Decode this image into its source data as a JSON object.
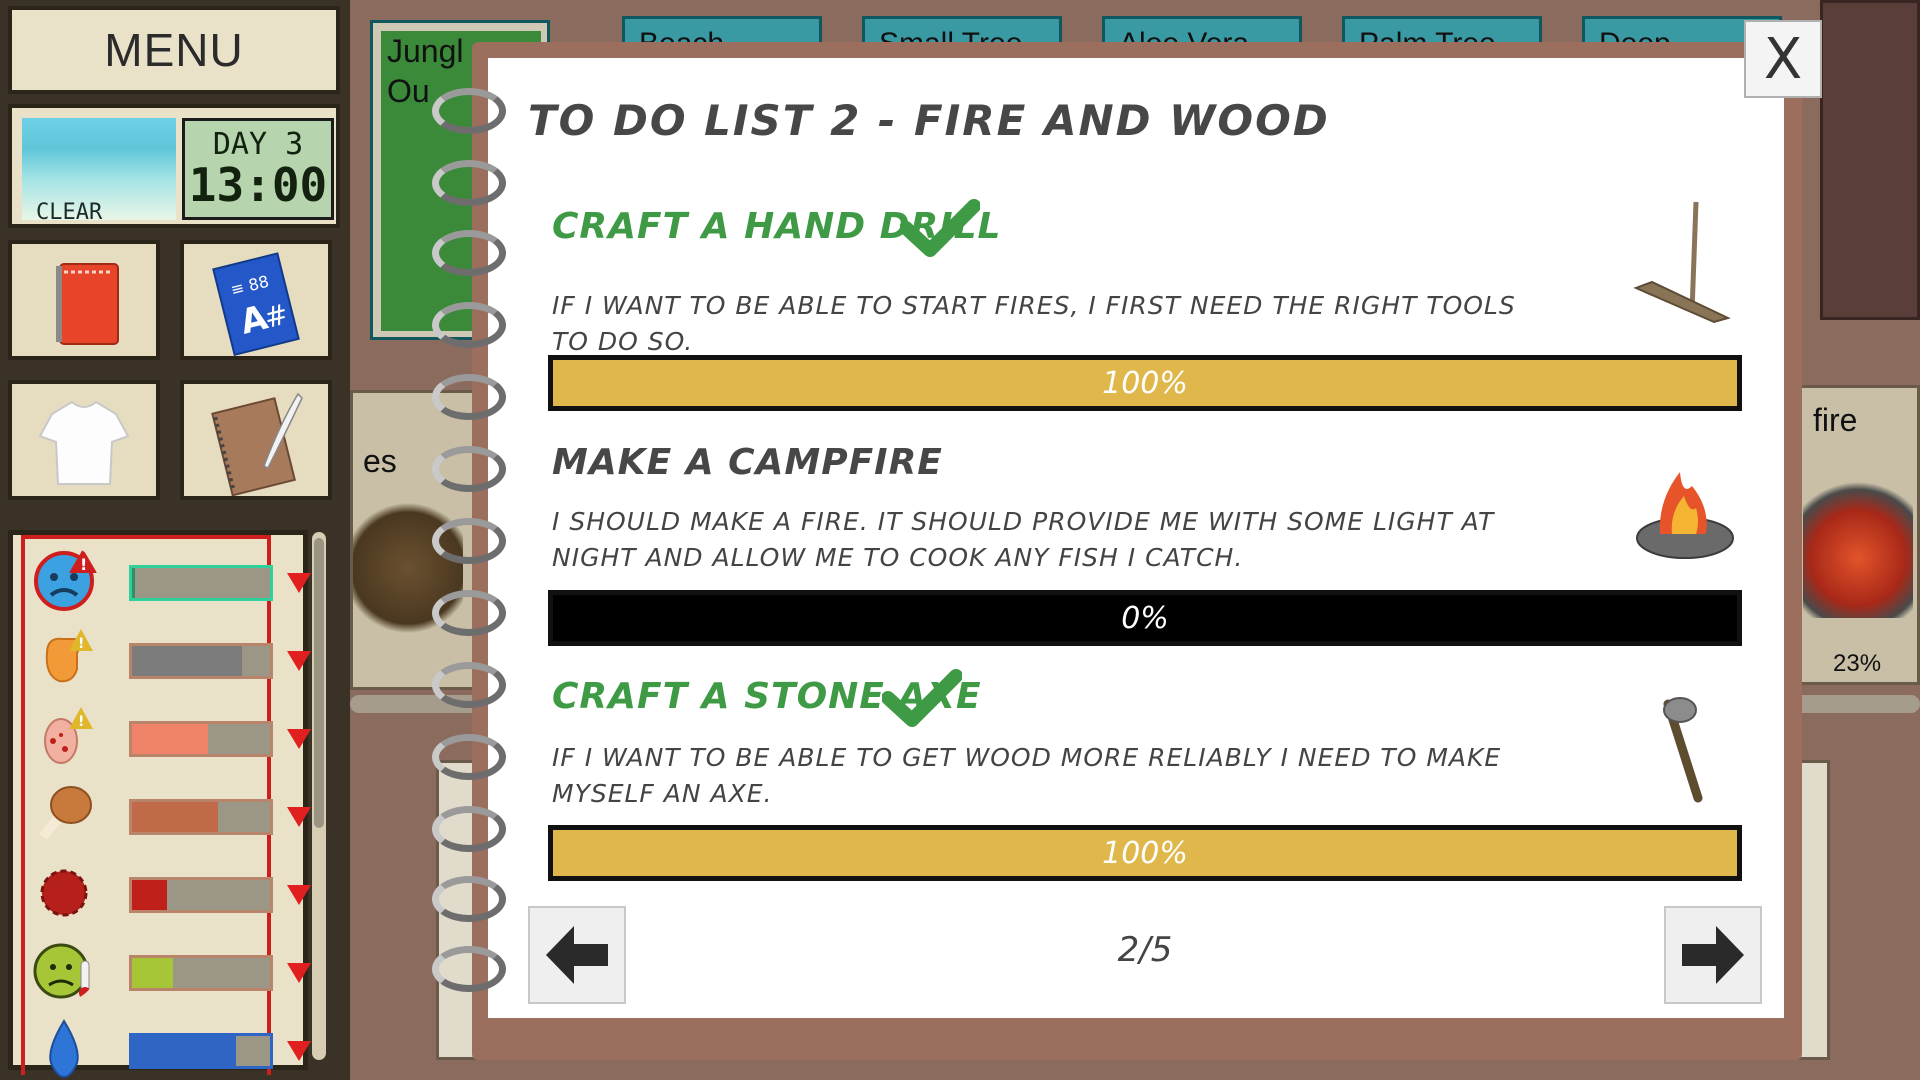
{
  "sidebar": {
    "menu_label": "MENU",
    "weather": "CLEAR",
    "day": "DAY 3",
    "time": "13:00",
    "inventory": [
      {
        "name": "red-notebook-icon"
      },
      {
        "name": "blue-map-icon"
      },
      {
        "name": "tshirt-icon"
      },
      {
        "name": "journal-quill-icon"
      }
    ],
    "stats": [
      {
        "name": "mood",
        "level": 0.02,
        "color": "#2f8f6a",
        "alert": true
      },
      {
        "name": "pain",
        "level": 0.8,
        "color": "#7c7c7c"
      },
      {
        "name": "foot-health",
        "level": 0.55,
        "color": "#f0826a"
      },
      {
        "name": "hunger",
        "level": 0.62,
        "color": "#c06a4a"
      },
      {
        "name": "blood",
        "level": 0.25,
        "color": "#c0201a"
      },
      {
        "name": "temperature",
        "level": 0.3,
        "color": "#a6c637"
      },
      {
        "name": "thirst",
        "level": 0.75,
        "color": "#2f65c5"
      }
    ]
  },
  "background": {
    "top_tabs": [
      "Beach",
      "Small Tree",
      "Aloe Vera",
      "Palm Tree",
      "Deep"
    ],
    "left_card_line1": "Jungl",
    "left_card_line2": "Ou",
    "left_label": "es",
    "right_label": "fire",
    "right_percent": "23%"
  },
  "notebook": {
    "title": "TO DO LIST 2 - FIRE AND WOOD",
    "tasks": [
      {
        "title": "CRAFT A HAND DRILL",
        "done": true,
        "description": "IF I WANT TO BE ABLE TO START FIRES, I FIRST NEED THE RIGHT TOOLS TO DO SO.",
        "progress": 1.0,
        "progress_label": "100%",
        "icon": "hand-drill-icon"
      },
      {
        "title": "MAKE A CAMPFIRE",
        "done": false,
        "description": "I SHOULD MAKE A FIRE. IT SHOULD PROVIDE ME WITH SOME LIGHT AT NIGHT AND ALLOW ME TO COOK ANY FISH I CATCH.",
        "progress": 0.0,
        "progress_label": "0%",
        "icon": "campfire-icon"
      },
      {
        "title": "CRAFT A STONE AXE",
        "done": true,
        "description": "IF I WANT TO BE ABLE TO GET WOOD MORE RELIABLY I NEED TO MAKE MYSELF AN AXE.",
        "progress": 1.0,
        "progress_label": "100%",
        "icon": "stone-axe-icon"
      }
    ],
    "page_indicator": "2/5",
    "close_label": "X"
  },
  "colors": {
    "done_green": "#3f9a46",
    "progress_gold": "#e0b74b",
    "notebook_border": "#9b6e5e"
  }
}
